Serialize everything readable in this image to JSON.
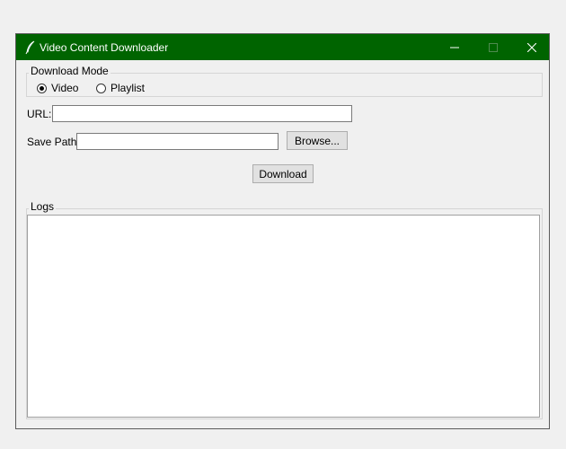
{
  "window": {
    "title": "Video Content Downloader",
    "titlebar_color": "#006400"
  },
  "download_mode": {
    "label": "Download Mode",
    "options": [
      {
        "label": "Video",
        "selected": true
      },
      {
        "label": "Playlist",
        "selected": false
      }
    ]
  },
  "url": {
    "label": "URL:",
    "value": ""
  },
  "save_path": {
    "label": "Save Path:",
    "value": "",
    "browse_label": "Browse..."
  },
  "download_button": {
    "label": "Download"
  },
  "logs": {
    "label": "Logs",
    "content": ""
  },
  "icons": {
    "app": "feather-icon",
    "minimize": "minimize-icon",
    "maximize": "maximize-icon",
    "close": "close-icon"
  }
}
